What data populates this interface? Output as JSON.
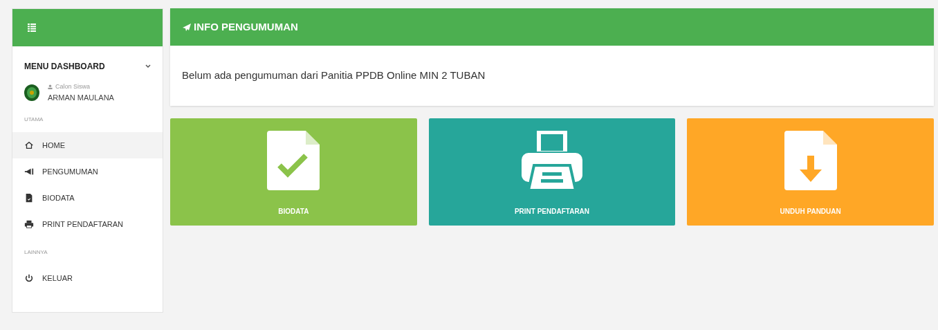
{
  "sidebar": {
    "title": "MENU DASHBOARD",
    "user": {
      "role": "Calon Siswa",
      "name": "ARMAN MAULANA"
    },
    "sections": [
      {
        "label": "UTAMA",
        "items": [
          {
            "label": "HOME",
            "kind": "home",
            "selected": true
          },
          {
            "label": "PENGUMUMAN",
            "kind": "megaphone",
            "selected": false
          },
          {
            "label": "BIODATA",
            "kind": "file",
            "selected": false
          },
          {
            "label": "PRINT PENDAFTARAN",
            "kind": "printer",
            "selected": false
          }
        ]
      },
      {
        "label": "LAINNYA",
        "items": [
          {
            "label": "KELUAR",
            "kind": "power",
            "selected": false
          }
        ]
      }
    ]
  },
  "announcement": {
    "title": "INFO PENGUMUMAN",
    "message": "Belum ada pengumuman dari Panitia PPDB Online MIN 2 TUBAN"
  },
  "tiles": [
    {
      "label": "BIODATA",
      "kind": "check",
      "color": "#8bc34a"
    },
    {
      "label": "PRINT PENDAFTARAN",
      "kind": "printer",
      "color": "#26a69a"
    },
    {
      "label": "UNDUH PANDUAN",
      "kind": "download",
      "color": "#ffa726"
    }
  ]
}
